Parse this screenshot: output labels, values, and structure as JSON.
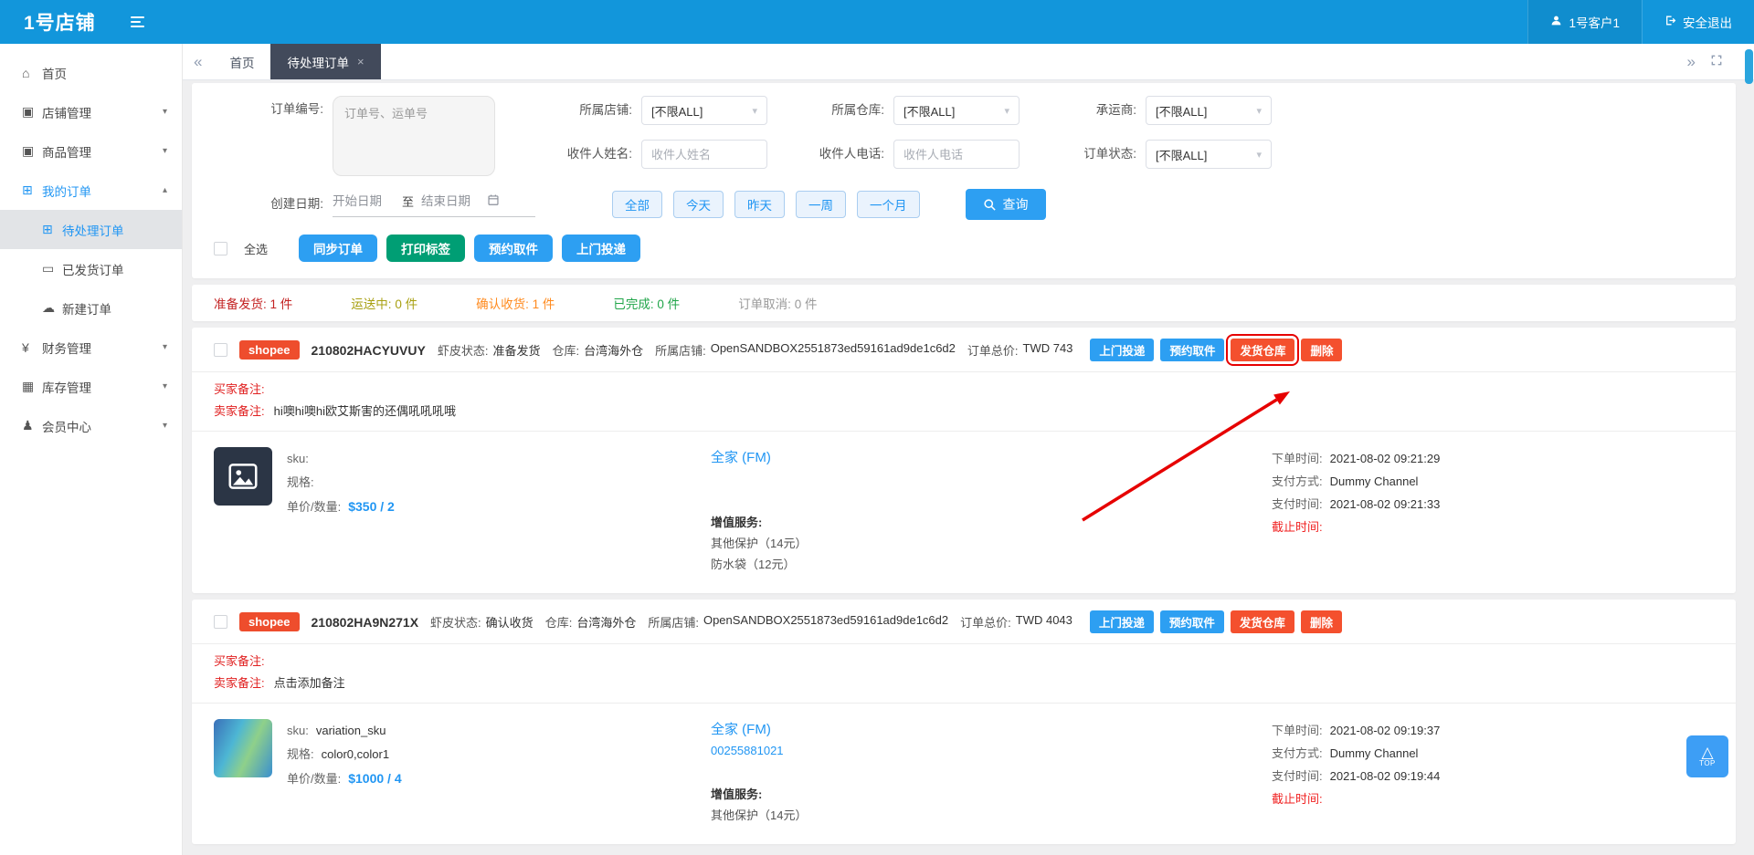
{
  "app": {
    "logo": "1号店铺",
    "user": "1号客户1",
    "logout": "安全退出"
  },
  "colors": {
    "header_blue": "#1296db",
    "primary_blue": "#2d9ff2",
    "green": "#009e74",
    "shopee_orange": "#ee4d2d",
    "action_orange": "#f4502e",
    "link_blue": "#2196f3",
    "annotation_red": "#e60000"
  },
  "glyphs": {
    "caret_down": "▾",
    "collapse_left": "«",
    "collapse_right": "»",
    "top_triangle": "△"
  },
  "tabs": [
    {
      "label": "首页"
    },
    {
      "label": "待处理订单",
      "close": "×"
    }
  ],
  "sidebar": [
    {
      "name": "sidebar-item-home",
      "icon": "home-icon",
      "glyph": "⌂",
      "label": "首页",
      "arrow": "",
      "cls": ""
    },
    {
      "name": "sidebar-item-shop-manage",
      "icon": "shop-bag-icon",
      "glyph": "▣",
      "label": "店铺管理",
      "arrow": "▾",
      "cls": ""
    },
    {
      "name": "sidebar-item-goods-manage",
      "icon": "goods-bag-icon",
      "glyph": "▣",
      "label": "商品管理",
      "arrow": "▾",
      "cls": ""
    },
    {
      "name": "sidebar-item-my-orders",
      "icon": "cart-icon",
      "glyph": "⊞",
      "label": "我的订单",
      "arrow": "▴",
      "cls": "blue"
    },
    {
      "name": "sidebar-item-pending-orders",
      "icon": "cart-icon",
      "glyph": "⊞",
      "label": "待处理订单",
      "arrow": "",
      "cls": "sub active"
    },
    {
      "name": "sidebar-item-shipped-orders",
      "icon": "truck-icon",
      "glyph": "▭",
      "label": "已发货订单",
      "arrow": "",
      "cls": "sub"
    },
    {
      "name": "sidebar-item-new-order",
      "icon": "cloud-upload-icon",
      "glyph": "☁",
      "label": "新建订单",
      "arrow": "",
      "cls": "sub"
    },
    {
      "name": "sidebar-item-finance",
      "icon": "yen-icon",
      "glyph": "¥",
      "label": "财务管理",
      "arrow": "▾",
      "cls": ""
    },
    {
      "name": "sidebar-item-inventory",
      "icon": "grid-icon",
      "glyph": "▦",
      "label": "库存管理",
      "arrow": "▾",
      "cls": ""
    },
    {
      "name": "sidebar-item-member",
      "icon": "person-icon",
      "glyph": "♟",
      "label": "会员中心",
      "arrow": "▾",
      "cls": ""
    }
  ],
  "filters": {
    "order_no_label": "订单编号:",
    "order_no_placeholder": "订单号、运单号",
    "selects": [
      {
        "label": "所属店铺:",
        "value": "[不限ALL]"
      },
      {
        "label": "所属仓库:",
        "value": "[不限ALL]"
      },
      {
        "label": "承运商:",
        "value": "[不限ALL]"
      }
    ],
    "inputs": [
      {
        "label": "收件人姓名:",
        "placeholder": "收件人姓名"
      },
      {
        "label": "收件人电话:",
        "placeholder": "收件人电话"
      }
    ],
    "status_select": {
      "label": "订单状态:",
      "value": "[不限ALL]"
    },
    "date": {
      "label": "创建日期:",
      "start_placeholder": "开始日期",
      "separator": "至",
      "end_placeholder": "结束日期"
    },
    "quick_ranges": [
      "全部",
      "今天",
      "昨天",
      "一周",
      "一个月"
    ],
    "search_label": "查询"
  },
  "toolbar": {
    "select_all": "全选",
    "buttons": [
      {
        "label": "同步订单",
        "variant": "blue",
        "name": "sync-orders-button"
      },
      {
        "label": "打印标签",
        "variant": "green",
        "name": "print-label-button"
      },
      {
        "label": "预约取件",
        "variant": "blue",
        "name": "pickup-appointment-button"
      },
      {
        "label": "上门投递",
        "variant": "blue",
        "name": "door-delivery-button"
      }
    ]
  },
  "summary": [
    {
      "label": "准备发货:",
      "value": "1 件",
      "color": "#c32222"
    },
    {
      "label": "运送中:",
      "value": "0 件",
      "color": "#a8a012"
    },
    {
      "label": "确认收货:",
      "value": "1 件",
      "color": "#ff8a1e"
    },
    {
      "label": "已完成:",
      "value": "0 件",
      "color": "#21a54a"
    },
    {
      "label": "订单取消:",
      "value": "0 件",
      "color": "#9a9a9a"
    }
  ],
  "orders": [
    {
      "platform": "shopee",
      "order_no": "210802HACYUVUY",
      "status_label": "虾皮状态:",
      "status": "准备发货",
      "warehouse_label": "仓库:",
      "warehouse": "台湾海外仓",
      "store_label": "所属店铺:",
      "store": "OpenSANDBOX2551873ed59161ad9de1c6d2",
      "total_label": "订单总价:",
      "total": "TWD 743",
      "actions": [
        {
          "label": "上门投递",
          "variant": "blue",
          "name": "door-delivery-button"
        },
        {
          "label": "预约取件",
          "variant": "blue",
          "name": "pickup-appointment-button"
        },
        {
          "label": "发货仓库",
          "variant": "orange annotated",
          "name": "ship-warehouse-button"
        },
        {
          "label": "删除",
          "variant": "orange",
          "name": "delete-button"
        }
      ],
      "buyer_note_label": "买家备注:",
      "buyer_note": "",
      "seller_note_label": "卖家备注:",
      "seller_note": "hi噢hi噢hi欧艾斯害的还偶吼吼吼哦",
      "sku_label": "sku:",
      "sku": "",
      "spec_label": "规格:",
      "spec": "",
      "price_label": "单价/数量:",
      "price": "$350 / 2",
      "logistics": "全家 (FM)",
      "tracking": "",
      "vas_label": "增值服务:",
      "vas": [
        "其他保护（14元）",
        "防水袋（12元）"
      ],
      "order_time_label": "下单时间:",
      "order_time": "2021-08-02 09:21:29",
      "pay_method_label": "支付方式:",
      "pay_method": "Dummy Channel",
      "pay_time_label": "支付时间:",
      "pay_time": "2021-08-02 09:21:33",
      "deadline_label": "截止时间:",
      "deadline": ""
    },
    {
      "platform": "shopee",
      "order_no": "210802HA9N271X",
      "status_label": "虾皮状态:",
      "status": "确认收货",
      "warehouse_label": "仓库:",
      "warehouse": "台湾海外仓",
      "store_label": "所属店铺:",
      "store": "OpenSANDBOX2551873ed59161ad9de1c6d2",
      "total_label": "订单总价:",
      "total": "TWD 4043",
      "actions": [
        {
          "label": "上门投递",
          "variant": "blue",
          "name": "door-delivery-button"
        },
        {
          "label": "预约取件",
          "variant": "blue",
          "name": "pickup-appointment-button"
        },
        {
          "label": "发货仓库",
          "variant": "orange",
          "name": "ship-warehouse-button"
        },
        {
          "label": "删除",
          "variant": "orange",
          "name": "delete-button"
        }
      ],
      "buyer_note_label": "买家备注:",
      "buyer_note": "",
      "seller_note_label": "卖家备注:",
      "seller_note": "点击添加备注",
      "sku_label": "sku:",
      "sku": "variation_sku",
      "spec_label": "规格:",
      "spec": "color0,color1",
      "price_label": "单价/数量:",
      "price": "$1000 / 4",
      "logistics": "全家 (FM)",
      "tracking": "00255881021",
      "vas_label": "增值服务:",
      "vas": [
        "其他保护（14元）"
      ],
      "order_time_label": "下单时间:",
      "order_time": "2021-08-02 09:19:37",
      "pay_method_label": "支付方式:",
      "pay_method": "Dummy Channel",
      "pay_time_label": "支付时间:",
      "pay_time": "2021-08-02 09:19:44",
      "deadline_label": "截止时间:",
      "deadline": ""
    }
  ],
  "top_button": "TOP"
}
